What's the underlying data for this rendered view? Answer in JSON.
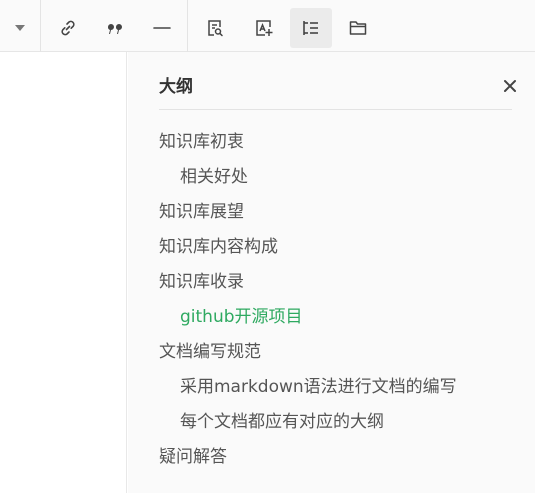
{
  "outline": {
    "title": "大纲",
    "items": [
      {
        "label": "知识库初衷",
        "level": 1,
        "active": false
      },
      {
        "label": "相关好处",
        "level": 2,
        "active": false
      },
      {
        "label": "知识库展望",
        "level": 1,
        "active": false
      },
      {
        "label": "知识库内容构成",
        "level": 1,
        "active": false
      },
      {
        "label": "知识库收录",
        "level": 1,
        "active": false
      },
      {
        "label": "github开源项目",
        "level": 2,
        "active": true
      },
      {
        "label": "文档编写规范",
        "level": 1,
        "active": false
      },
      {
        "label": "采用markdown语法进行文档的编写",
        "level": 2,
        "active": false
      },
      {
        "label": "每个文档都应有对应的大纲",
        "level": 2,
        "active": false
      },
      {
        "label": "疑问解答",
        "level": 1,
        "active": false
      }
    ]
  },
  "toolbar": {
    "buttons": [
      {
        "icon": "chevron-down-icon"
      },
      {
        "icon": "link-icon"
      },
      {
        "icon": "quote-icon"
      },
      {
        "icon": "horizontal-rule-icon"
      },
      {
        "icon": "document-search-icon"
      },
      {
        "icon": "image-text-icon"
      },
      {
        "icon": "outline-icon",
        "active": true
      },
      {
        "icon": "folder-icon"
      }
    ]
  },
  "colors": {
    "active_item": "#2ea960",
    "text": "#555555",
    "icon": "#444444",
    "panel_background": "#fafafa"
  }
}
